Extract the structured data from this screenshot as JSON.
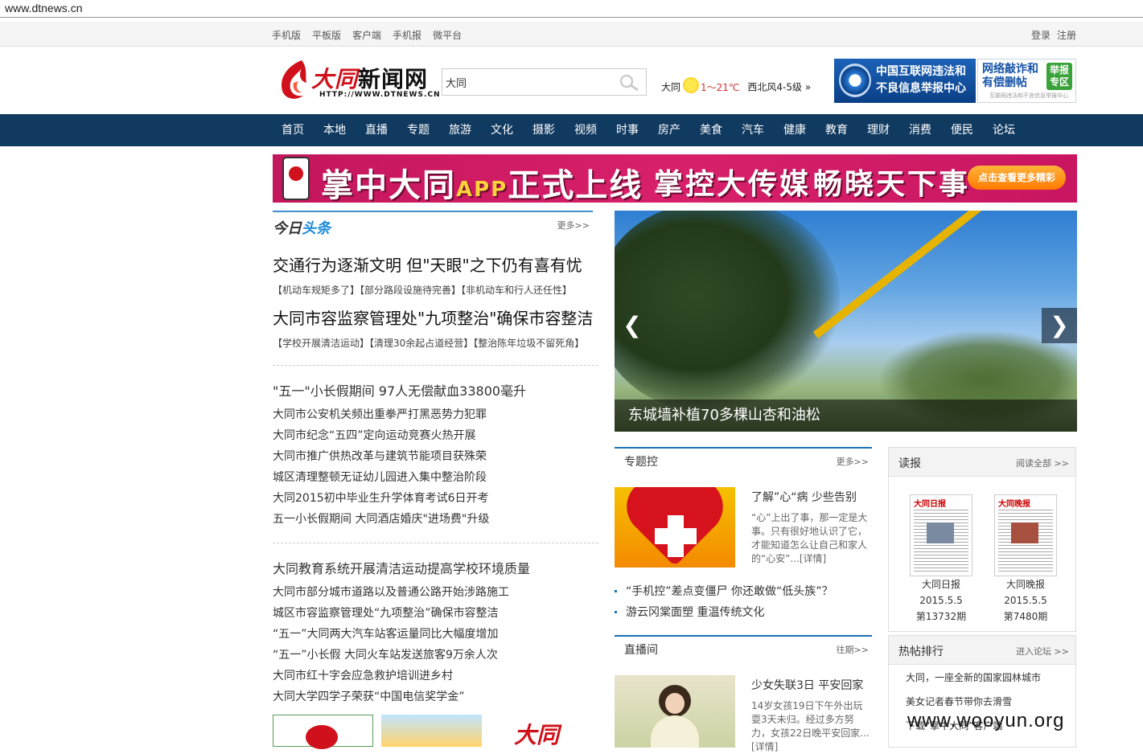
{
  "browser": {
    "url": "www.dtnews.cn"
  },
  "topbar": {
    "links": [
      "手机版",
      "平板版",
      "客户端",
      "手机报",
      "微平台"
    ],
    "login": "登录",
    "register": "注册"
  },
  "header": {
    "logo_name_a": "大同",
    "logo_name_b": "新闻网",
    "logo_url": "HTTP://WWW.DTNEWS.CN",
    "search_value": "大同",
    "weather": {
      "city": "大同",
      "temp": "1～21℃",
      "wind": "西北风4-5级"
    },
    "ad1_line1": "中国互联网违法和",
    "ad1_line2": "不良信息举报中心",
    "ad2_line1": "网络敲诈和",
    "ad2_line2": "有偿删帖",
    "ad2_tag": "举报专区",
    "ad2_small": "互联网违法和不良信息举报中心"
  },
  "nav": [
    "首页",
    "本地",
    "直播",
    "专题",
    "旅游",
    "文化",
    "摄影",
    "视频",
    "时事",
    "房产",
    "美食",
    "汽车",
    "健康",
    "教育",
    "理财",
    "消费",
    "便民",
    "论坛"
  ],
  "banner": {
    "title": "掌中大同",
    "app": "APP",
    "launch": "正式上线",
    "slogan1": "掌控大传媒",
    "slogan2": "畅晓天下事",
    "cta": "点击查看更多精彩"
  },
  "headlines": {
    "title_a": "今日",
    "title_b": "头条",
    "more": "更多>>",
    "top1": "交通行为逐渐文明 但\"天眼\"之下仍有喜有忧",
    "top1_subs": "【机动车规矩多了】【部分路段设施待完善】【非机动车和行人还任性】",
    "top2": "大同市容监察管理处\"九项整治\"确保市容整洁",
    "top2_subs": "【学校开展清洁运动】【清理30余起占道经营】【整治陈年垃圾不留死角】",
    "lead1": "\"五一\"小长假期间 97人无偿献血33800毫升",
    "list1": [
      "大同市公安机关频出重拳严打黑恶势力犯罪",
      "大同市纪念“五四”定向运动竞赛火热开展",
      "大同市推广供热改革与建筑节能项目获殊荣",
      "城区清理整顿无证幼儿园进入集中整治阶段",
      "大同2015初中毕业生升学体育考试6日开考",
      "五一小长假期间 大同酒店婚庆\"进场费\"升级"
    ],
    "lead2": "大同教育系统开展清洁运动提高学校环境质量",
    "list2": [
      "大同市部分城市道路以及普通公路开始涉路施工",
      "城区市容监察管理处“九项整治”确保市容整洁",
      "“五一”大同两大汽车站客运量同比大幅度增加",
      "“五一”小长假 大同火车站发送旅客9万余人次",
      "大同市红十字会应急救护培训进乡村",
      "大同大学四学子荣获“中国电信奖学金”"
    ]
  },
  "slider": {
    "caption": "东城墙补植70多棵山杏和油松",
    "prev": "❮",
    "next": "❯"
  },
  "zhuanti": {
    "title": "专题控",
    "more": "更多>>",
    "headline": "了解”心“病 少些告别",
    "desc": "“心”上出了事，那一定是大事。只有很好地认识了它，才能知道怎么让自己和家人的“心安”...[详情]",
    "items": [
      "“手机控”差点变僵尸 你还敢做“低头族”？",
      "游云冈棠面塑 重温传统文化"
    ]
  },
  "zhibo": {
    "title": "直播间",
    "more": "往期>>",
    "headline": "少女失联3日 平安回家",
    "desc": "14岁女孩19日下午外出玩耍3天未归。经过多方努力，女孩22日晚平安回家...[详情]"
  },
  "dubao": {
    "title": "读报",
    "more": "阅读全部 >>",
    "papers": [
      {
        "masthead": "大同日报",
        "name": "大同日报",
        "date": "2015.5.5",
        "issue": "第13732期"
      },
      {
        "masthead": "大同晚报",
        "name": "大同晚报",
        "date": "2015.5.5",
        "issue": "第7480期"
      }
    ]
  },
  "hot": {
    "title": "热帖排行",
    "more": "进入论坛 >>",
    "items": [
      "大同，一座全新的国家园林城市",
      "美女记者春节带你去滑雪",
      "下载“掌中大同”客户端"
    ]
  },
  "watermark": "www.wooyun.org",
  "colors": {
    "nav_bg": "#113a61",
    "accent": "#1b6fb5",
    "banner": "#d01e66"
  }
}
